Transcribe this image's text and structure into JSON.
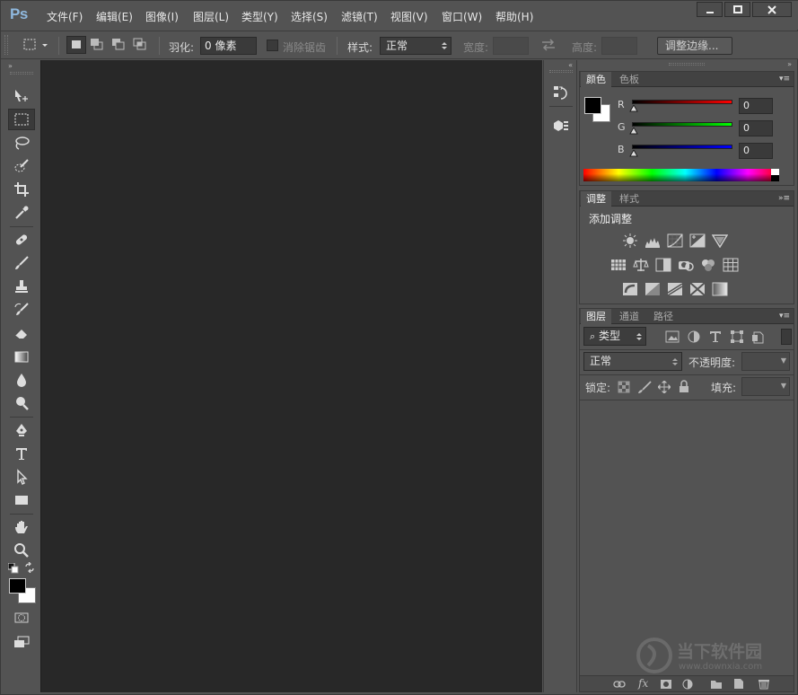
{
  "app": {
    "logo": "Ps"
  },
  "menu": [
    "文件(F)",
    "编辑(E)",
    "图像(I)",
    "图层(L)",
    "类型(Y)",
    "选择(S)",
    "滤镜(T)",
    "视图(V)",
    "窗口(W)",
    "帮助(H)"
  ],
  "options": {
    "feather_label": "羽化:",
    "feather_value": "0 像素",
    "antialias_label": "消除锯齿",
    "style_label": "样式:",
    "style_value": "正常",
    "width_label": "宽度:",
    "height_label": "高度:",
    "refine_button": "调整边缘..."
  },
  "color_panel": {
    "tabs": [
      "颜色",
      "色板"
    ],
    "r_label": "R",
    "g_label": "G",
    "b_label": "B",
    "r_value": "0",
    "g_value": "0",
    "b_value": "0"
  },
  "adjust_panel": {
    "tabs": [
      "调整",
      "样式"
    ],
    "title": "添加调整"
  },
  "layers_panel": {
    "tabs": [
      "图层",
      "通道",
      "路径"
    ],
    "filter_value": "类型",
    "blend_value": "正常",
    "opacity_label": "不透明度:",
    "lock_label": "锁定:",
    "fill_label": "填充:",
    "footer_fx": "fx"
  },
  "watermark": {
    "text": "当下软件园",
    "url": "www.downxia.com"
  },
  "colors": {
    "accent": "#8fb8de",
    "canvas": "#282828",
    "panel": "#535353"
  }
}
